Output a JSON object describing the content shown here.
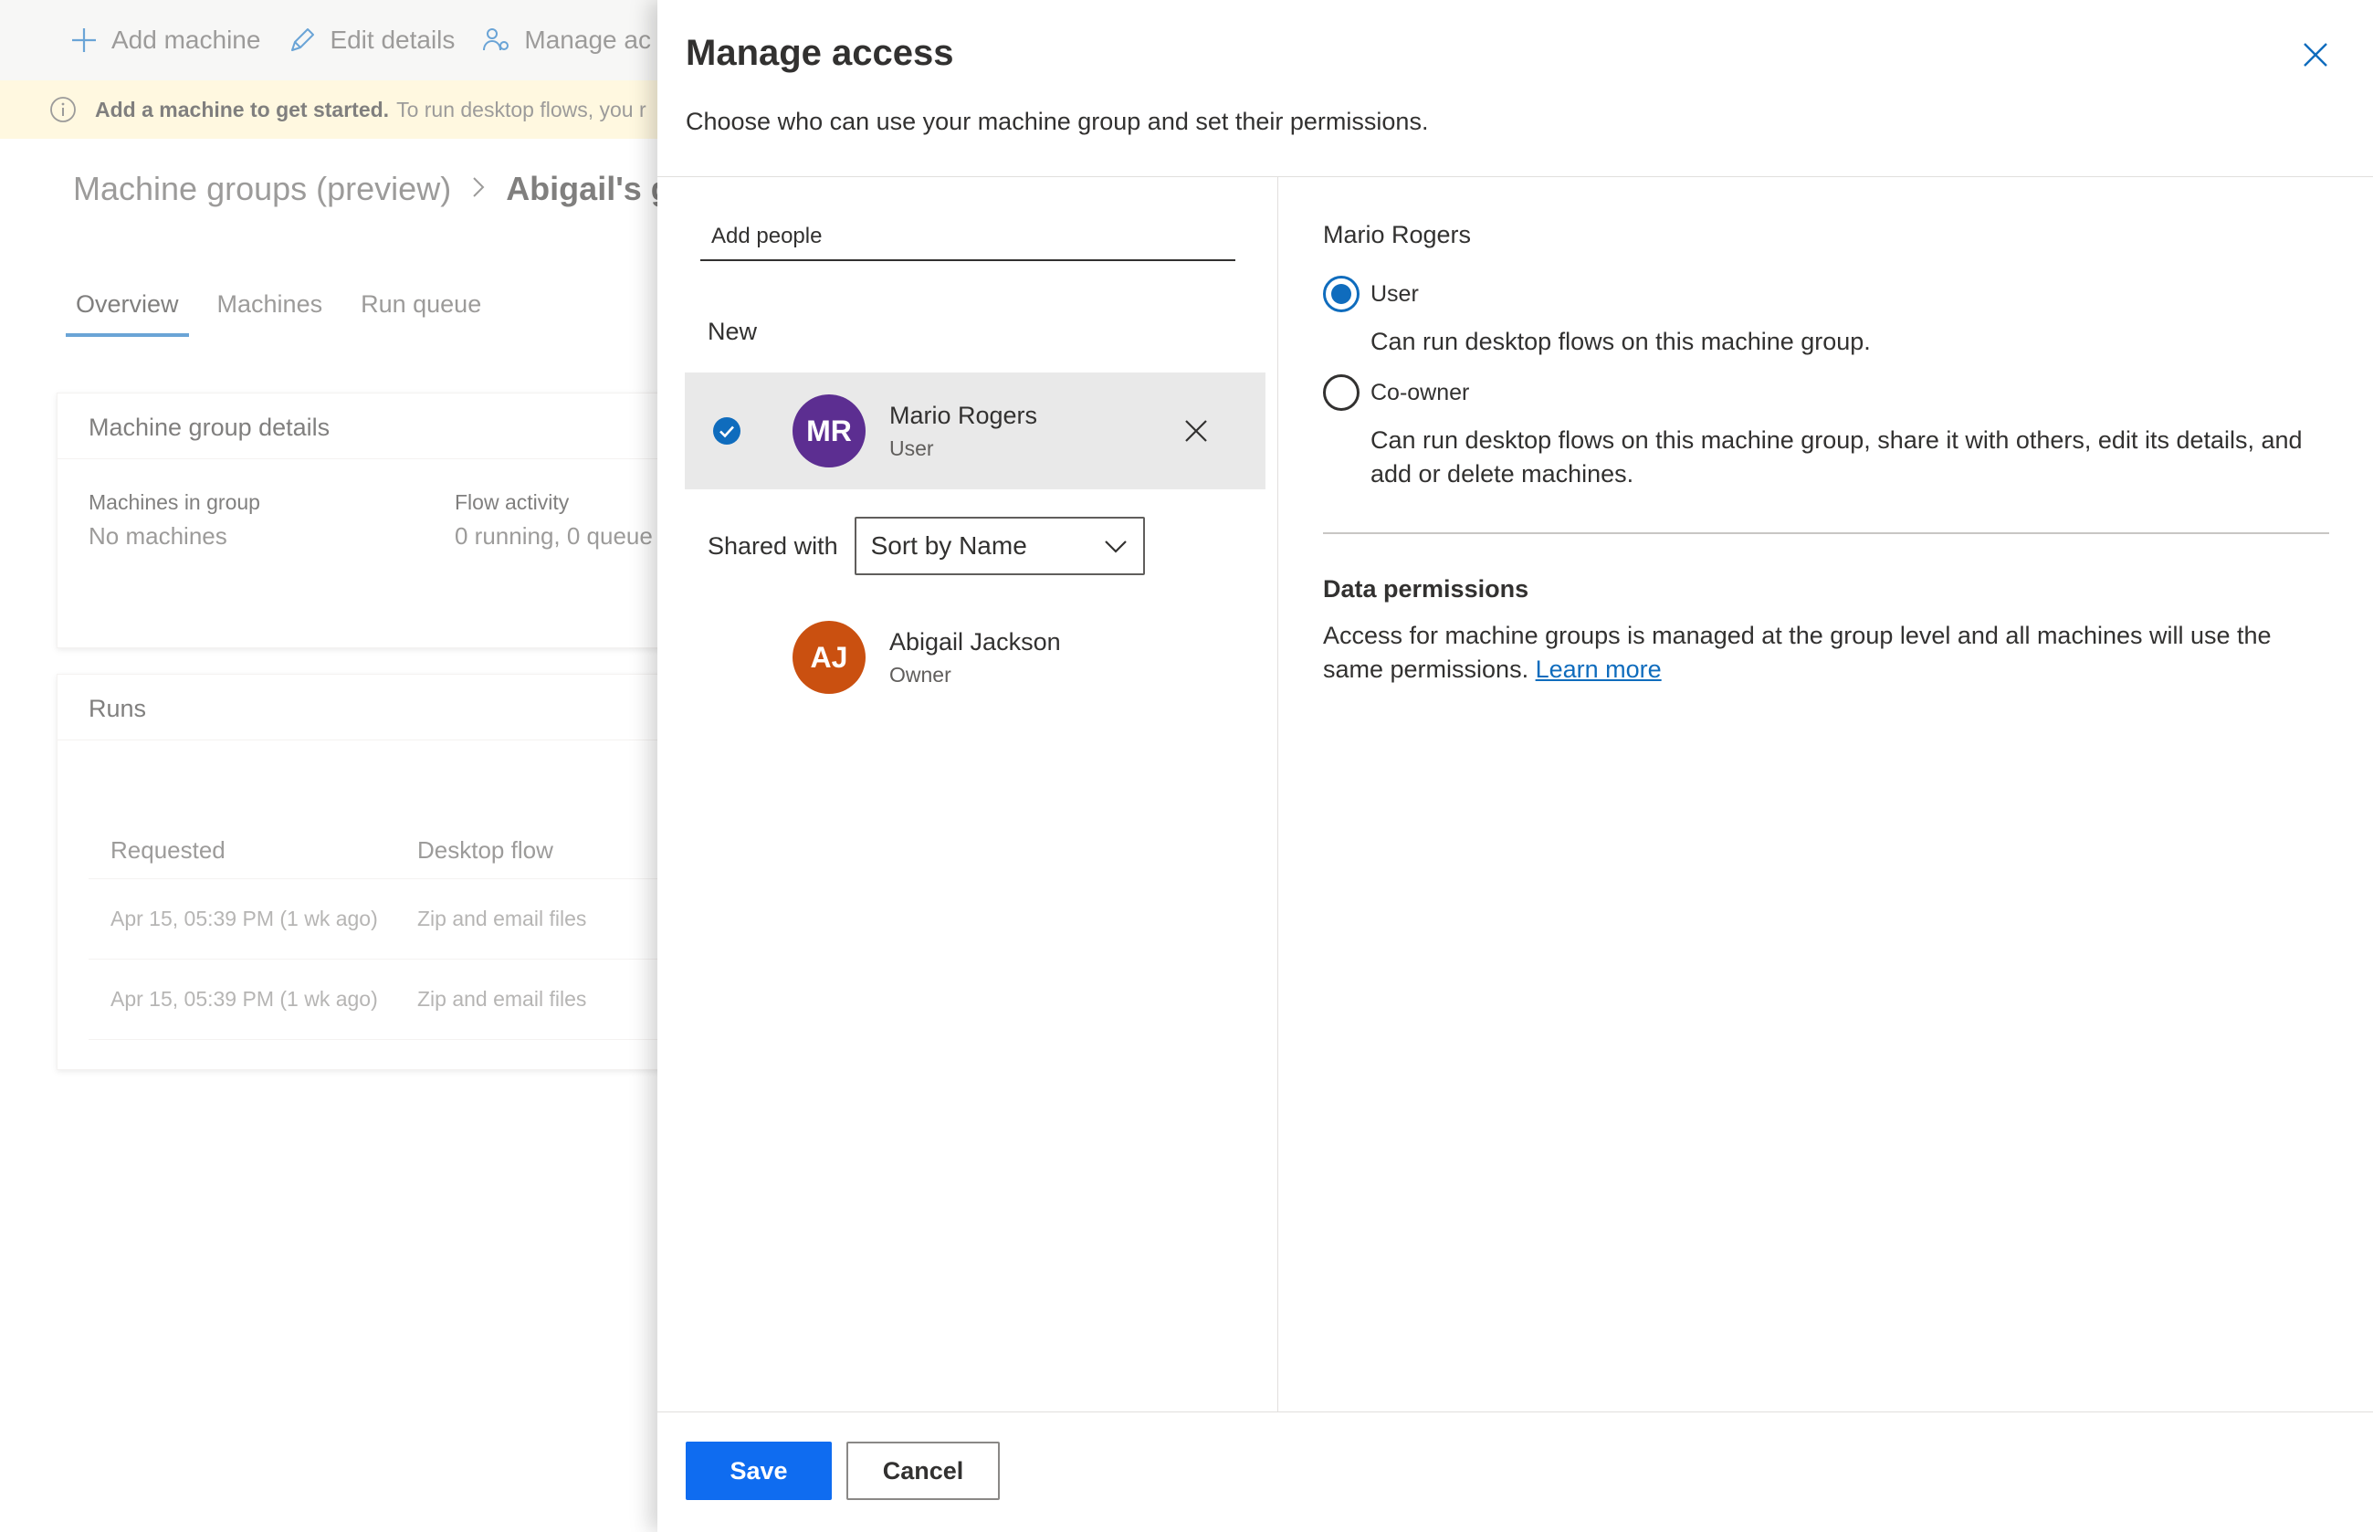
{
  "background": {
    "commands": [
      {
        "label": "Add machine",
        "icon": "plus-icon"
      },
      {
        "label": "Edit details",
        "icon": "pencil-icon"
      },
      {
        "label": "Manage ac",
        "icon": "people-settings-icon"
      }
    ],
    "message": {
      "bold": "Add a machine to get started.",
      "text": "To run desktop flows, you r"
    },
    "breadcrumb": {
      "parent": "Machine groups (preview)",
      "current": "Abigail's g"
    },
    "tabs": [
      "Overview",
      "Machines",
      "Run queue"
    ],
    "details_card": {
      "title": "Machine group details",
      "machines_label": "Machines in group",
      "machines_value": "No machines",
      "activity_label": "Flow activity",
      "activity_value": "0 running, 0 queue"
    },
    "runs_card": {
      "title": "Runs",
      "columns": [
        "Requested",
        "Desktop flow"
      ],
      "rows": [
        [
          "Apr 15, 05:39 PM (1 wk ago)",
          "Zip and email files"
        ],
        [
          "Apr 15, 05:39 PM (1 wk ago)",
          "Zip and email files"
        ]
      ]
    }
  },
  "panel": {
    "title": "Manage access",
    "subtitle": "Choose who can use your machine group and set their permissions.",
    "add_people_placeholder": "Add people",
    "new_label": "New",
    "new_people": [
      {
        "initials": "MR",
        "name": "Mario Rogers",
        "role": "User",
        "color": "#5c2e91"
      }
    ],
    "shared_with_label": "Shared with",
    "sort_value": "Sort by Name",
    "shared_people": [
      {
        "initials": "AJ",
        "name": "Abigail Jackson",
        "role": "Owner",
        "color": "#ca5010"
      }
    ],
    "selected_person": "Mario Rogers",
    "roles": [
      {
        "label": "User",
        "description": "Can run desktop flows on this machine group.",
        "checked": true
      },
      {
        "label": "Co-owner",
        "description": "Can run desktop flows on this machine group, share it with others, edit its details, and add or delete machines.",
        "checked": false
      }
    ],
    "data_permissions": {
      "title": "Data permissions",
      "text": "Access for machine groups is managed at the group level and all machines will use the same permissions.",
      "link": "Learn more"
    },
    "save_label": "Save",
    "cancel_label": "Cancel"
  },
  "colors": {
    "accent": "#0f6cbd",
    "primary_button": "#0f6cf0",
    "selected_row": "#e9e9e9"
  }
}
